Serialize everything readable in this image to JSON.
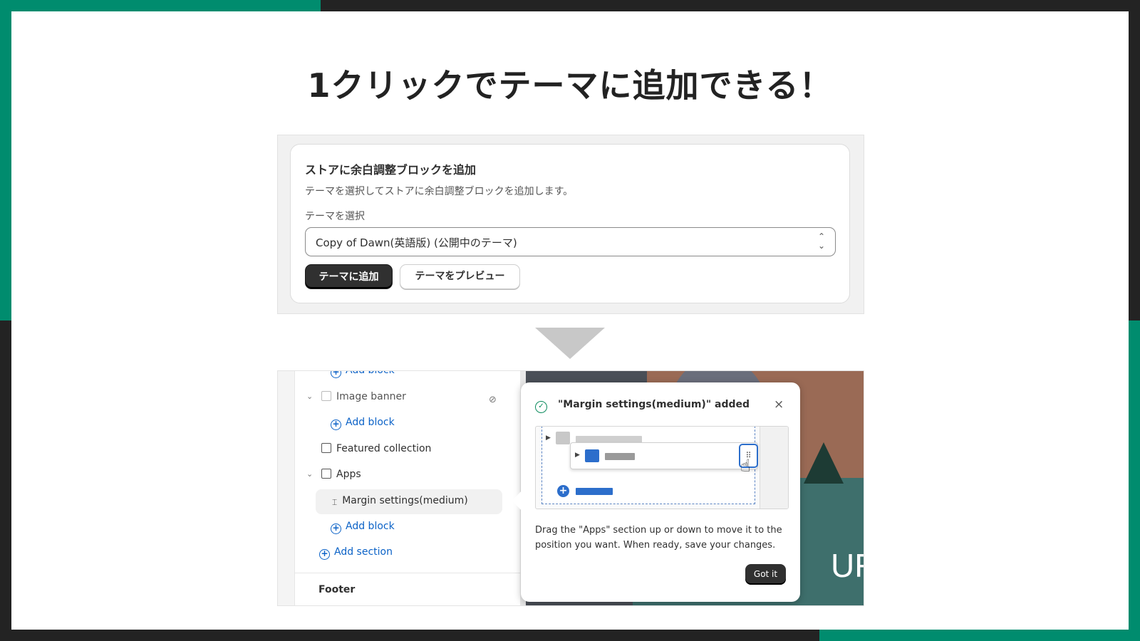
{
  "headline": "1クリックでテーマに追加できる！",
  "card": {
    "title": "ストアに余白調整ブロックを追加",
    "description": "テーマを選択してストアに余白調整ブロックを追加します。",
    "select_label": "テーマを選択",
    "select_value": "Copy of Dawn(英語版) (公開中のテーマ)",
    "add_button": "テーマに追加",
    "preview_button": "テーマをプレビュー"
  },
  "editor": {
    "sidebar": {
      "top_partial": "Add block",
      "image_banner": "Image banner",
      "add_block_1": "Add block",
      "featured_collection": "Featured collection",
      "apps": "Apps",
      "margin_settings": "Margin settings(medium)",
      "add_block_2": "Add block",
      "add_section": "Add section",
      "footer": "Footer"
    },
    "preview_text": "UR",
    "popover": {
      "title": "\"Margin settings(medium)\" added",
      "body": "Drag the \"Apps\" section up or down to move it to the position you want. When ready, save your changes.",
      "button": "Got it"
    }
  },
  "colors": {
    "accent_green": "#008c6e",
    "frame_dark": "#232323",
    "primary_button": "#303030",
    "link_blue": "#0b62c7",
    "drag_blue": "#2c6ecb"
  },
  "icons": [
    "chevron-updown-icon",
    "chevron-down-icon",
    "image-icon",
    "eye-slash-icon",
    "plus-circle-icon",
    "section-icon",
    "block-icon",
    "check-circle-icon",
    "close-icon",
    "drag-handle-icon",
    "hand-pointer-icon"
  ]
}
